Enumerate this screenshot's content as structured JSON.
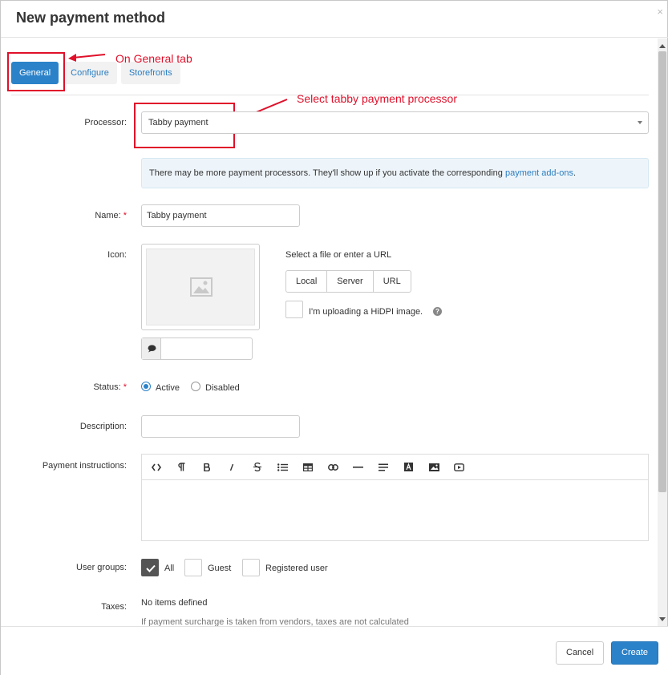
{
  "dialog": {
    "title": "New payment method",
    "close_glyph": "×"
  },
  "tabs": [
    {
      "label": "General",
      "active": true
    },
    {
      "label": "Configure",
      "active": false
    },
    {
      "label": "Storefronts",
      "active": false
    }
  ],
  "annotations": {
    "tab_note": "On General tab",
    "processor_note": "Select tabby payment processor",
    "color": "#e0102a"
  },
  "form": {
    "processor": {
      "label": "Processor:",
      "value": "Tabby payment"
    },
    "info": {
      "text": "There may be more payment processors. They'll show up if you activate the corresponding ",
      "link": "payment add-ons",
      "suffix": "."
    },
    "name": {
      "label": "Name:",
      "required_mark": "*",
      "value": "Tabby payment"
    },
    "icon": {
      "label": "Icon:",
      "select_label": "Select a file or enter a URL",
      "sources": [
        "Local",
        "Server",
        "URL"
      ],
      "hidpi_label": "I'm uploading a HiDPI image.",
      "hidpi_checked": false,
      "help_glyph": "?"
    },
    "status": {
      "label": "Status:",
      "required_mark": "*",
      "options": [
        {
          "label": "Active",
          "selected": true
        },
        {
          "label": "Disabled",
          "selected": false
        }
      ]
    },
    "description": {
      "label": "Description:",
      "value": ""
    },
    "instructions": {
      "label": "Payment instructions:",
      "toolbar": [
        "code-view-icon",
        "paragraph-icon",
        "bold-icon",
        "italic-icon",
        "strikethrough-icon",
        "unordered-list-icon",
        "table-icon",
        "link-icon",
        "horizontal-rule-icon",
        "align-icon",
        "text-color-icon",
        "image-icon",
        "video-icon"
      ]
    },
    "user_groups": {
      "label": "User groups:",
      "options": [
        {
          "label": "All",
          "checked": true
        },
        {
          "label": "Guest",
          "checked": false
        },
        {
          "label": "Registered user",
          "checked": false
        }
      ]
    },
    "taxes": {
      "label": "Taxes:",
      "empty_text": "No items defined",
      "note": "If payment surcharge is taken from vendors, taxes are not calculated"
    }
  },
  "footer": {
    "cancel_label": "Cancel",
    "create_label": "Create"
  },
  "colors": {
    "primary": "#2b82c9",
    "link": "#2b7dc0",
    "info_bg": "#eef5fa"
  }
}
